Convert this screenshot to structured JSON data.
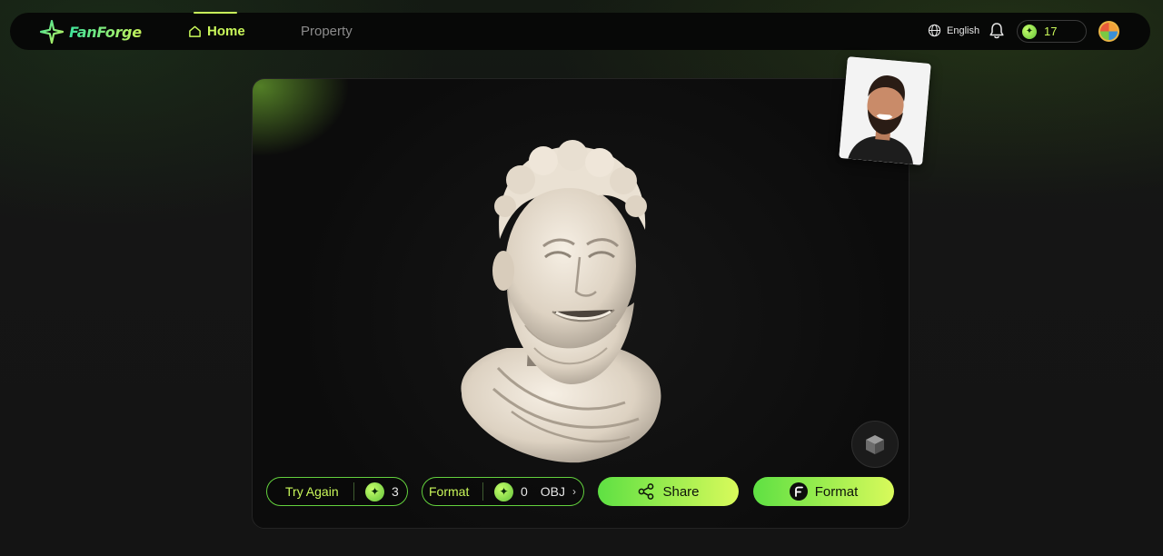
{
  "brand": {
    "name": "FanForge",
    "logo_icon": "sparkle-star-icon"
  },
  "nav": {
    "home_label": "Home",
    "property_label": "Property",
    "home_icon": "home-icon"
  },
  "header": {
    "language": "English",
    "language_icon": "globe-icon",
    "notification_icon": "bell-icon",
    "credits": "17",
    "credits_icon": "coin-icon",
    "avatar_icon": "user-avatar"
  },
  "viewer": {
    "model_icon": "cube-icon",
    "reference_photo": "reference-portrait-photo"
  },
  "actions": {
    "try_again_label": "Try Again",
    "try_again_cost": "3",
    "format_label": "Format",
    "format_cost": "0",
    "format_type": "OBJ",
    "share_label": "Share",
    "format_button_label": "Format"
  },
  "colors": {
    "accent_green": "#c9f75a",
    "button_gradient_start": "#5ee043",
    "button_gradient_end": "#d9fa5b",
    "outline_border": "#63d13d"
  }
}
